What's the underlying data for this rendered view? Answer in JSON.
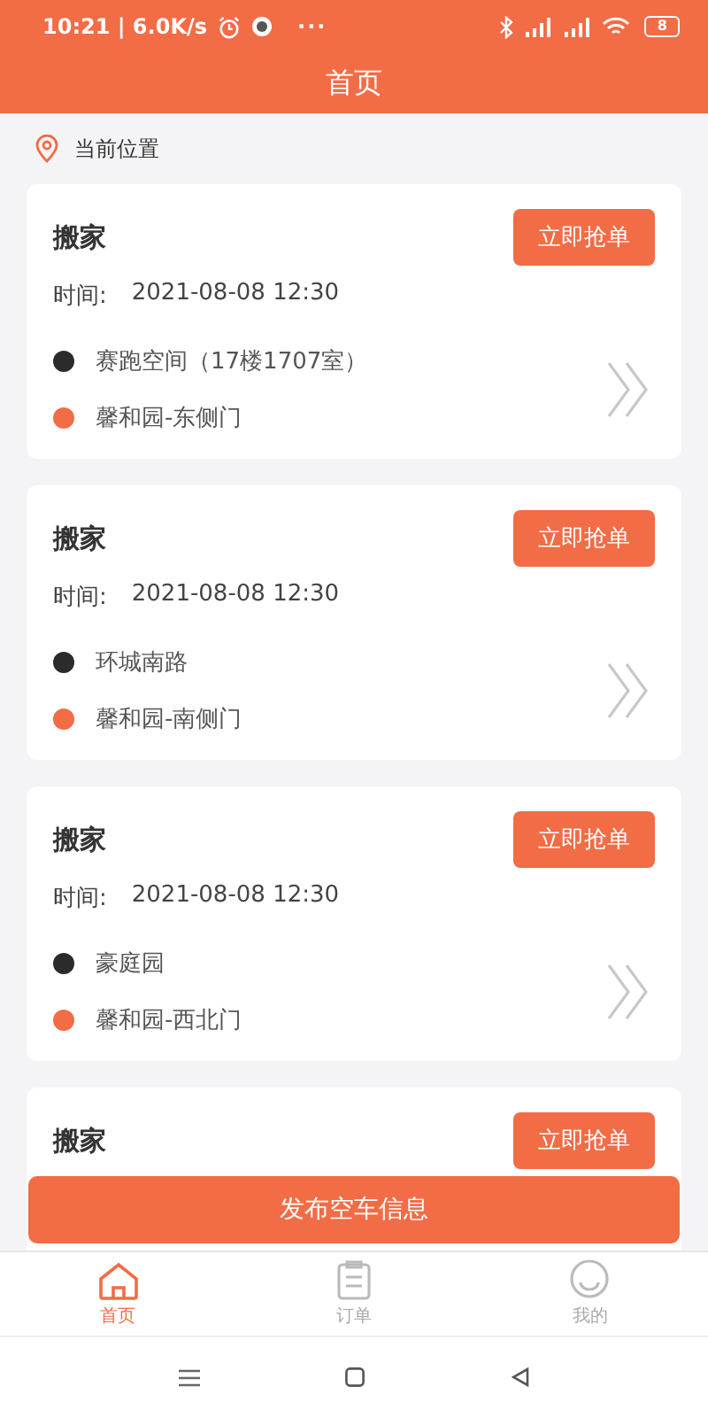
{
  "status_bar": {
    "time": "10:21 | 6.0K/s",
    "dots": "···",
    "battery": "8"
  },
  "header": {
    "title": "首页"
  },
  "location": {
    "label": "当前位置"
  },
  "orders": [
    {
      "title": "搬家",
      "button": "立即抢单",
      "time_label": "时间:",
      "time": "2021-08-08 12:30",
      "from": "赛跑空间（17楼1707室）",
      "to": "馨和园-东侧门"
    },
    {
      "title": "搬家",
      "button": "立即抢单",
      "time_label": "时间:",
      "time": "2021-08-08 12:30",
      "from": "环城南路",
      "to": "馨和园-南侧门"
    },
    {
      "title": "搬家",
      "button": "立即抢单",
      "time_label": "时间:",
      "time": "2021-08-08 12:30",
      "from": "豪庭园",
      "to": "馨和园-西北门"
    },
    {
      "title": "搬家",
      "button": "立即抢单"
    }
  ],
  "publish_button": "发布空车信息",
  "tabs": [
    {
      "label": "首页",
      "kind": "home",
      "selected": true
    },
    {
      "label": "订单",
      "kind": "orders",
      "selected": false
    },
    {
      "label": "我的",
      "kind": "profile",
      "selected": false
    }
  ]
}
